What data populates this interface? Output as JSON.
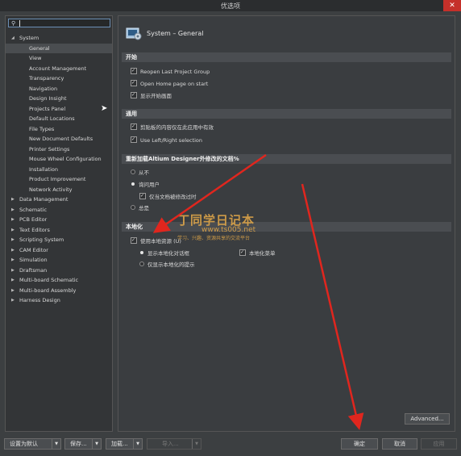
{
  "window": {
    "title": "优选项",
    "close_glyph": "✕"
  },
  "search": {
    "value": "",
    "icon": "search-icon"
  },
  "tree": [
    {
      "label": "System",
      "level": 0,
      "expanded": true
    },
    {
      "label": "General",
      "level": 1,
      "selected": true
    },
    {
      "label": "View",
      "level": 1
    },
    {
      "label": "Account Management",
      "level": 1
    },
    {
      "label": "Transparency",
      "level": 1
    },
    {
      "label": "Navigation",
      "level": 1
    },
    {
      "label": "Design Insight",
      "level": 1
    },
    {
      "label": "Projects Panel",
      "level": 1
    },
    {
      "label": "Default Locations",
      "level": 1
    },
    {
      "label": "File Types",
      "level": 1
    },
    {
      "label": "New Document Defaults",
      "level": 1
    },
    {
      "label": "Printer Settings",
      "level": 1
    },
    {
      "label": "Mouse Wheel Configuration",
      "level": 1
    },
    {
      "label": "Installation",
      "level": 1
    },
    {
      "label": "Product Improvement",
      "level": 1
    },
    {
      "label": "Network Activity",
      "level": 1
    },
    {
      "label": "Data Management",
      "level": 0
    },
    {
      "label": "Schematic",
      "level": 0
    },
    {
      "label": "PCB Editor",
      "level": 0
    },
    {
      "label": "Text Editors",
      "level": 0
    },
    {
      "label": "Scripting System",
      "level": 0
    },
    {
      "label": "CAM Editor",
      "level": 0
    },
    {
      "label": "Simulation",
      "level": 0
    },
    {
      "label": "Draftsman",
      "level": 0
    },
    {
      "label": "Multi-board Schematic",
      "level": 0
    },
    {
      "label": "Multi-board Assembly",
      "level": 0
    },
    {
      "label": "Harness Design",
      "level": 0
    }
  ],
  "page": {
    "title": "System – General"
  },
  "sections": {
    "start": {
      "title": "开始",
      "options": [
        {
          "label": "Reopen Last Project Group",
          "checked": true
        },
        {
          "label": "Open Home page on start",
          "checked": true
        },
        {
          "label": "显示开始画面",
          "checked": true
        }
      ]
    },
    "general": {
      "title": "通用",
      "options": [
        {
          "label": "剪贴板的内容仅在此应用中有效",
          "checked": true
        },
        {
          "label": "Use Left/Right selection",
          "checked": true
        }
      ]
    },
    "reload": {
      "title": "重新加载Altium Designer外修改的文档%",
      "radios": [
        {
          "label": "从不",
          "selected": false
        },
        {
          "label": "询问用户",
          "selected": true
        },
        {
          "label": "总是",
          "selected": false
        }
      ],
      "sub_option": {
        "label": "仅当文档被修改过时",
        "checked": true
      }
    },
    "localize": {
      "title": "本地化",
      "use_local": {
        "label": "使用本地资源 (U)",
        "checked": true
      },
      "radios": [
        {
          "label": "显示本地化对话框",
          "selected": true
        },
        {
          "label": "仅显示本地化的提示",
          "selected": false
        }
      ],
      "menu_option": {
        "label": "本地化菜单",
        "checked": true
      }
    }
  },
  "buttons": {
    "advanced": "Advanced...",
    "set_default": "设置为默认",
    "save": "保存...",
    "load": "加载...",
    "import": "导入...",
    "ok": "确定",
    "cancel": "取消",
    "apply": "应用"
  },
  "watermark": {
    "line1": "丁同学日记本",
    "url": "www.ts005.net",
    "line2": "学习、兴趣、资源共享的交流平台"
  },
  "colors": {
    "background": "#3c3f41",
    "panel": "#3a3d40",
    "section": "#4a4d51",
    "close": "#c5302a",
    "arrow": "#e0261e",
    "watermark": "#e6aa49"
  }
}
